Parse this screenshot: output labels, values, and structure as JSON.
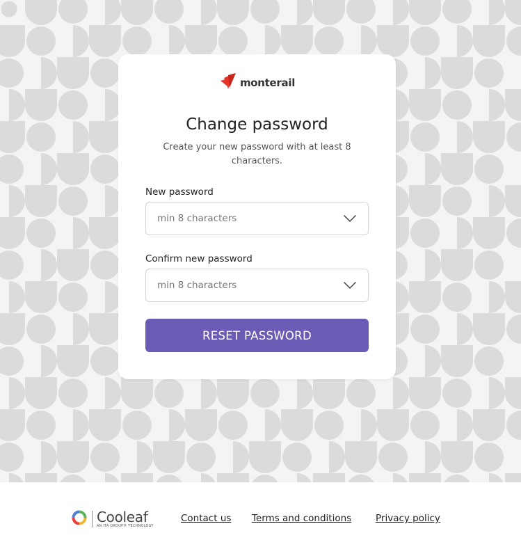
{
  "brand": {
    "name": "monterail",
    "accent_color": "#e5332a"
  },
  "form": {
    "title": "Change password",
    "subtitle": "Create your new password with at least 8 characters.",
    "new_password": {
      "label": "New password",
      "placeholder": "min 8 characters",
      "value": ""
    },
    "confirm_password": {
      "label": "Confirm new password",
      "placeholder": "min 8 characters",
      "value": ""
    },
    "submit_label": "RESET PASSWORD",
    "submit_color": "#6b5bb5"
  },
  "footer": {
    "logo_name": "Cooleaf",
    "logo_tagline": "AN ITA GROUP® TECHNOLOGY",
    "links": [
      {
        "label": "Contact us"
      },
      {
        "label": "Terms and conditions"
      },
      {
        "label": "Privacy policy"
      }
    ]
  }
}
